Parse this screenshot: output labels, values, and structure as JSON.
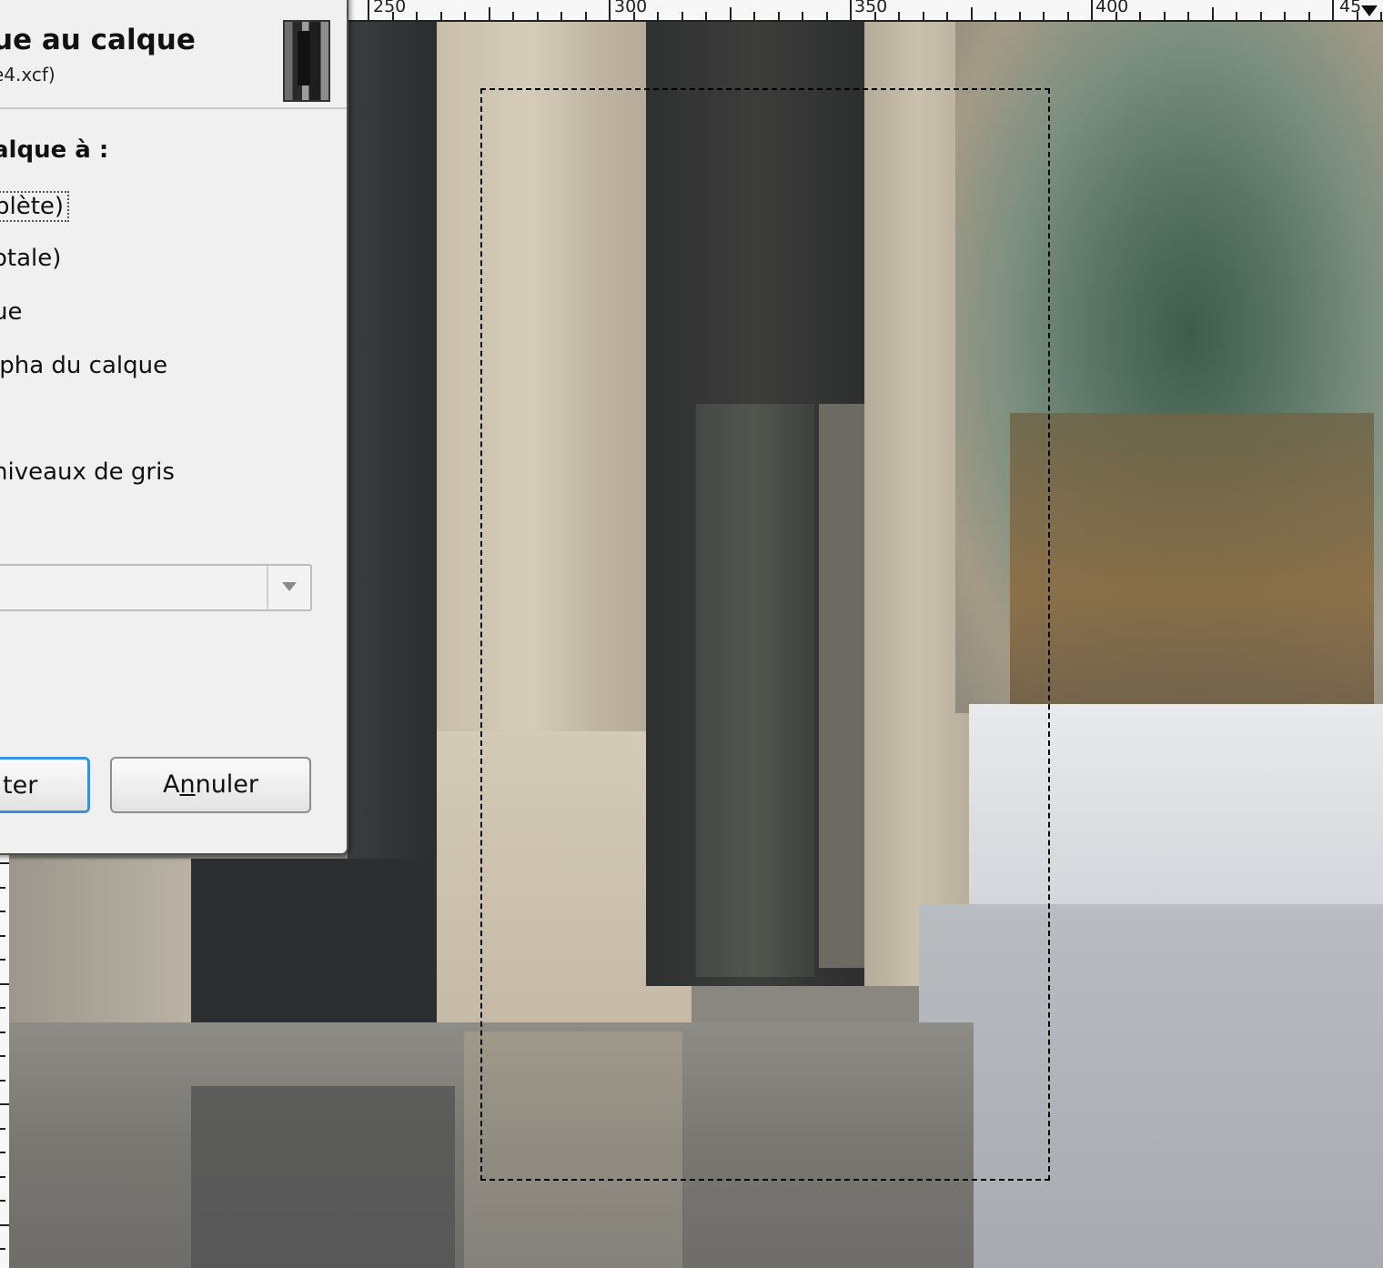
{
  "ruler": {
    "labels": [
      "250",
      "300",
      "350",
      "400",
      "45"
    ]
  },
  "dialog": {
    "title": "ue au calque",
    "subtitle": "e4.xcf)",
    "section_label": "alque à :",
    "options": [
      "plète)",
      "otale)",
      "ue",
      "lpha du calque",
      "niveaux de gris"
    ],
    "combo_value": "",
    "buttons": {
      "primary": "ter",
      "cancel_before": "A",
      "cancel_mnemonic": "n",
      "cancel_after": "nuler"
    }
  },
  "colors": {
    "selection": "#f2e000",
    "accent_focus": "#3c8fd8",
    "dialog_bg": "#f0f0f0"
  },
  "icons": {
    "layer_thumbnail": "layer-thumbnail-icon",
    "combo_arrow": "chevron-down-icon",
    "ruler_marker": "ruler-position-marker-icon"
  }
}
